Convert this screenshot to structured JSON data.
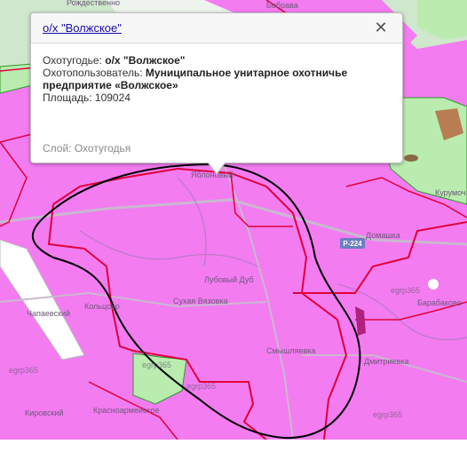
{
  "popup": {
    "title": "о/х \"Волжское\"",
    "rows": [
      {
        "label": "Охотугодье: ",
        "value": "о/х \"Волжское\""
      },
      {
        "label": "Охотопользователь: ",
        "value": "Муниципальное унитарное охотничье предприятие «Волжское»"
      },
      {
        "label": "Площадь: ",
        "value": "109024"
      }
    ],
    "layer": "Слой: Охотугодья",
    "close_symbol": "✕"
  },
  "map": {
    "road_badge": "Р-224",
    "place_labels": [
      "Рождественно",
      "Бобрава",
      "Яблоновый",
      "Лубовый Дуб",
      "Сухая Вязовка",
      "Кольцово",
      "Чапаевский",
      "Смышляевка",
      "Дмитриевка",
      "Домашка",
      "Кировский",
      "Красноармейское",
      "Барабаково",
      "Курумоч"
    ],
    "watermarks": [
      "egrp365",
      "egrp365",
      "egrp365",
      "egrp365",
      "egrp365"
    ],
    "colors": {
      "hunting_area": "#f37cf1",
      "boundary": "#e0003c",
      "green_area": "#b9ecae",
      "forest_outline": "#2b9a2b",
      "hand_drawn_outline": "#000000",
      "road": "#c9b9cf",
      "river": "#ffffff"
    }
  }
}
